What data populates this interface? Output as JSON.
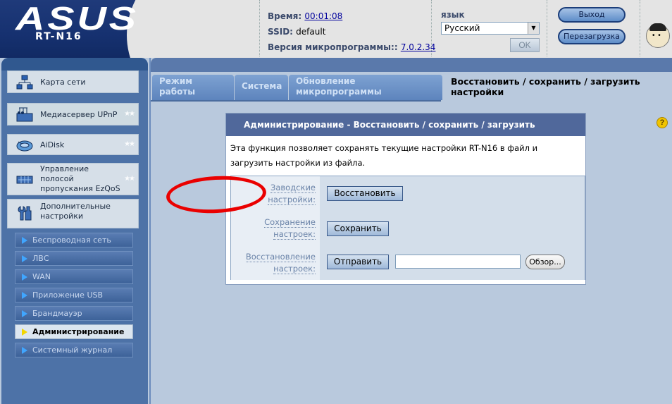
{
  "header": {
    "brand": "ASUS",
    "model": "RT-N16",
    "time_label": "Время:",
    "time_value": "00:01:08",
    "ssid_label": "SSID:",
    "ssid_value": "default",
    "firmware_label": "Версия микропрограммы::",
    "firmware_value": "7.0.2.34",
    "language_label": "язык",
    "language_value": "Русский",
    "ok_label": "OK",
    "logout_label": "Выход",
    "reboot_label": "Перезагрузка"
  },
  "sidebar": {
    "items": [
      {
        "label": "Карта сети",
        "icon": "network-map-icon"
      },
      {
        "label": "Медиасервер UPnP",
        "icon": "media-server-icon"
      },
      {
        "label": "AiDisk",
        "icon": "aidisk-icon"
      },
      {
        "label": "Управление полосой пропускания EzQoS",
        "icon": "qos-icon"
      },
      {
        "label": "Дополнительные настройки",
        "icon": "wrench-icon"
      }
    ],
    "sub_items": [
      {
        "label": "Беспроводная сеть"
      },
      {
        "label": "ЛВС"
      },
      {
        "label": "WAN"
      },
      {
        "label": "Приложение USB"
      },
      {
        "label": "Брандмауэр"
      },
      {
        "label": "Администрирование"
      },
      {
        "label": "Системный журнал"
      }
    ],
    "stars": "★★"
  },
  "tabs": [
    {
      "label": "Режим работы"
    },
    {
      "label": "Система"
    },
    {
      "label": "Обновление микропрограммы"
    },
    {
      "label": "Восстановить / сохранить / загрузить настройки"
    }
  ],
  "panel": {
    "title": "Администрирование - Восстановить / сохранить / загрузить настройки",
    "description": "Эта функция позволяет сохранять текущие настройки RT-N16 в файл и загрузить настройки из файла.",
    "rows": [
      {
        "label": "Заводские настройки:",
        "button": "Восстановить"
      },
      {
        "label": "Сохранение настроек:",
        "button": "Сохранить"
      },
      {
        "label": "Восстановление настроек:",
        "button": "Отправить",
        "browse": "Обзор..."
      }
    ]
  },
  "help": "?",
  "colors": {
    "annotation": "#ea0000",
    "header_bg": "#1f3a7a",
    "sidebar_bg": "#4d72a7",
    "panel_title_bg": "#50689b"
  }
}
